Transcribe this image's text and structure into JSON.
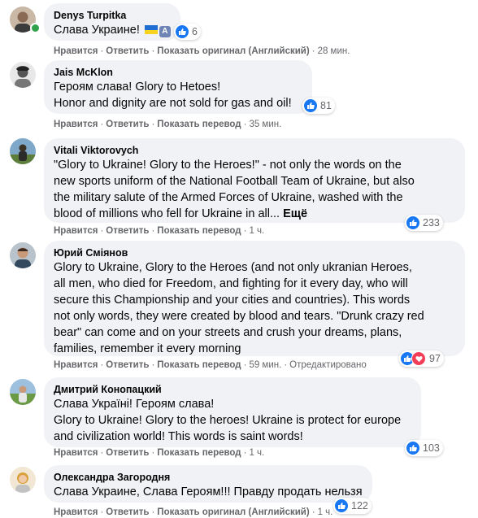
{
  "comments": [
    {
      "author": "Denys Turpitka",
      "text": "Слава Украине!",
      "badge": "A",
      "reactions": "6",
      "actions": {
        "like": "Нравится",
        "reply": "Ответить",
        "translate": "Показать оригинал (Английский)",
        "time": "28 мин."
      }
    },
    {
      "author": "Jais McKlon",
      "text": "Героям слава! Glory to Hetoes!\nHonor and dignity are not sold for gas and oil!",
      "reactions": "81",
      "actions": {
        "like": "Нравится",
        "reply": "Ответить",
        "translate": "Показать перевод",
        "time": "35 мин."
      }
    },
    {
      "author": "Vitali Viktorovych",
      "text": "\"Glory to Ukraine! Glory to the Heroes!\" - not only the words on the\nnew sports uniform of the National Football Team of Ukraine, but also\nthe military salute of the Armed Forces of Ukraine, washed with the\nblood of millions who fell for Ukraine in all...",
      "more": "Ещё",
      "reactions": "233",
      "actions": {
        "like": "Нравится",
        "reply": "Ответить",
        "translate": "Показать перевод",
        "time": "1 ч."
      }
    },
    {
      "author": "Юрий Смiянов",
      "text": "Glory to Ukraine, Glory to the Heroes (and not only ukranian Heroes,\nall men, who died for Freedom, and fighting for it every day, who will\nsecure this Championship and your cities and countries). This words\nnot only words, they were created by blood and tears. \"Drunk crazy red\nbear\" can come and on your streets and crush your dreams, plans,\nfamilies, remember it every morning",
      "reactions": "97",
      "actions": {
        "like": "Нравится",
        "reply": "Ответить",
        "translate": "Показать перевод",
        "time": "59 мин.",
        "edited": "Отредактировано"
      }
    },
    {
      "author": "Дмитрий Конопацкий",
      "text": "Слава Україні! Героям слава!\nGlory to Ukraine! Glory to the heroes! Ukraine is protect for europe\nand civilization world! This words is saint words!",
      "reactions": "103",
      "actions": {
        "like": "Нравится",
        "reply": "Ответить",
        "translate": "Показать перевод",
        "time": "1 ч."
      }
    },
    {
      "author": "Олександра Загородня",
      "text": "Слава Украине, Слава Героям!!! Правду продать нельзя",
      "reactions": "122",
      "actions": {
        "like": "Нравится",
        "reply": "Ответить",
        "translate": "Показать оригинал (Английский)",
        "time": "1 ч."
      }
    }
  ],
  "colors": {
    "like": "#1877f2",
    "heart": "#f33e58",
    "bubble": "#f0f2f5",
    "meta": "#65676b",
    "online": "#31a24c"
  }
}
